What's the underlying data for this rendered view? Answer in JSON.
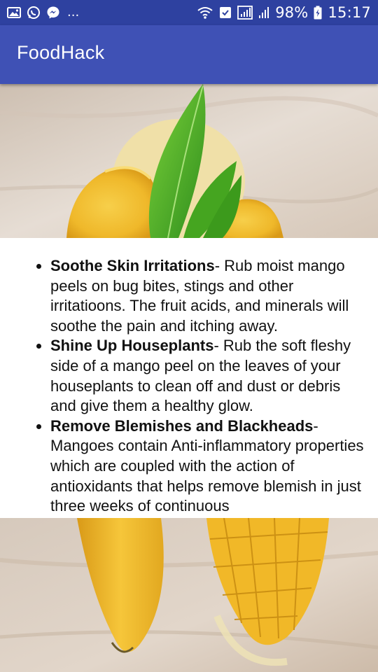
{
  "status_bar": {
    "left_icons": [
      "image-icon",
      "whatsapp-icon",
      "messenger-icon"
    ],
    "more": "...",
    "right_icons": [
      "wifi-icon",
      "nfc-icon",
      "signal-icon",
      "signal-icon",
      "battery-icon"
    ],
    "battery": "98%",
    "time": "15:17"
  },
  "app_bar": {
    "title": "FoodHack"
  },
  "tips": [
    {
      "title": "Soothe Skin Irritations",
      "text": "- Rub moist mango peels on bug bites, stings and other irritatioons. The fruit acids, and minerals will soothe the pain and itching away."
    },
    {
      "title": "Shine Up Houseplants",
      "text": "- Rub the soft fleshy side of a mango peel on the leaves of your houseplants to clean off and dust or debris and give them a healthy glow."
    },
    {
      "title": "Remove Blemishes and Blackheads",
      "text": "- Mangoes contain Anti-inflammatory properties which are coupled with the action of antioxidants that helps remove blemish in just three weeks of continuous"
    }
  ],
  "colors": {
    "status_bar": "#2e41a0",
    "app_bar": "#3f51b5",
    "content_bg": "#ffffff",
    "mango": "#f2bd2c",
    "leaf": "#4cae23"
  }
}
